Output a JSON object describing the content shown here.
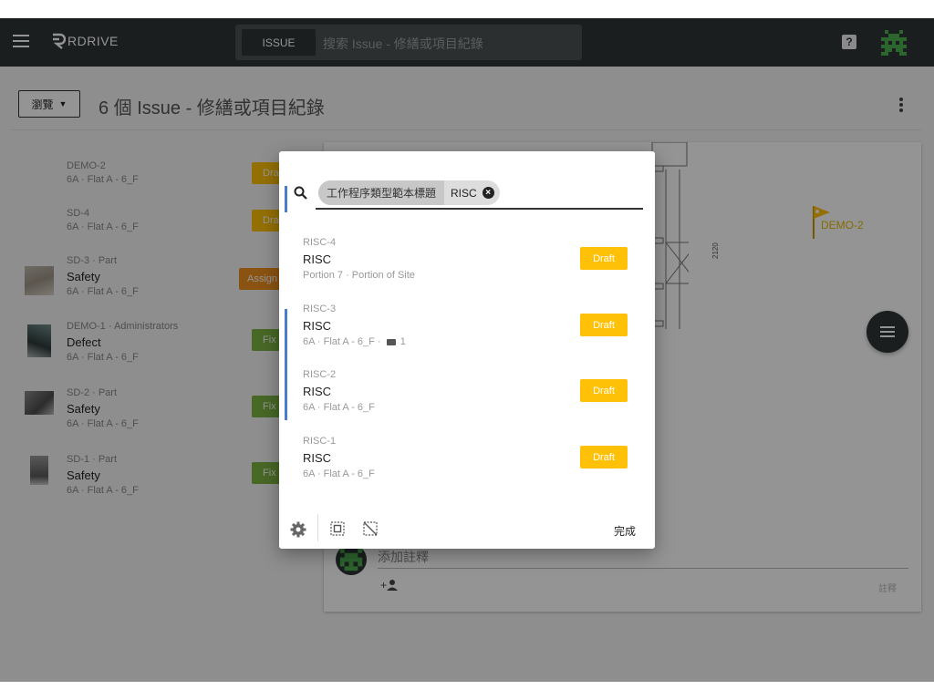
{
  "topbar": {
    "brand": "RDRIVE",
    "search_scope": "ISSUE",
    "search_placeholder": "搜索 Issue - 修繕或項目紀錄",
    "help_glyph": "?"
  },
  "subheader": {
    "browse_label": "瀏覽",
    "page_title": "6 個 Issue - 修繕或項目紀錄"
  },
  "colors": {
    "draft": "#ffc107",
    "assign": "#f0901e",
    "fix": "#7cb342",
    "topbar": "#2d3436",
    "accent_bar": "#4a7cc9"
  },
  "issues": [
    {
      "code": "DEMO-2",
      "name": "",
      "location": "6A · Flat A - 6_F",
      "status": "Draft"
    },
    {
      "code": "SD-4",
      "name": "",
      "location": "6A · Flat A - 6_F",
      "status": "Draft"
    },
    {
      "code": "SD-3 · Part",
      "name": "Safety",
      "location": "6A · Flat A - 6_F",
      "status": "Assign"
    },
    {
      "code": "DEMO-1 · Administrators",
      "name": "Defect",
      "location": "6A · Flat A - 6_F",
      "status": "Fix"
    },
    {
      "code": "SD-2 · Part",
      "name": "Safety",
      "location": "6A · Flat A - 6_F",
      "status": "Fix"
    },
    {
      "code": "SD-1 · Part",
      "name": "Safety",
      "location": "6A · Flat A - 6_F",
      "status": "Fix"
    }
  ],
  "detail": {
    "pin_label": "DEMO-2",
    "dimension_label": "2120",
    "comment_placeholder": "添加註釋",
    "comment_button": "註釋"
  },
  "modal": {
    "filter_key": "工作程序類型範本標題",
    "filter_value": "RISC",
    "items": [
      {
        "code": "RISC-4",
        "title": "RISC",
        "sub": "Portion 7 · Portion of Site",
        "status": "Draft",
        "selected": false,
        "files": ""
      },
      {
        "code": "RISC-3",
        "title": "RISC",
        "sub": "6A · Flat A - 6_F ·",
        "status": "Draft",
        "selected": true,
        "files": "1"
      },
      {
        "code": "RISC-2",
        "title": "RISC",
        "sub": "6A · Flat A - 6_F",
        "status": "Draft",
        "selected": true,
        "files": ""
      },
      {
        "code": "RISC-1",
        "title": "RISC",
        "sub": "6A · Flat A - 6_F",
        "status": "Draft",
        "selected": false,
        "files": ""
      }
    ],
    "done_label": "完成"
  }
}
